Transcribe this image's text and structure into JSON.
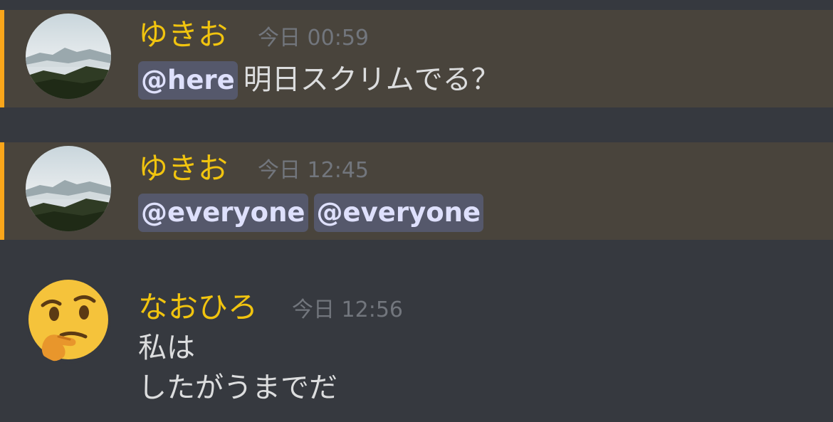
{
  "colors": {
    "background": "#36393f",
    "highlight_background": "#49443c",
    "highlight_border": "#faa61a",
    "username": "#f1c40f",
    "timestamp": "#72767d",
    "text": "#dcddde",
    "mention_text": "#dee0fc"
  },
  "messages": [
    {
      "author": "ゆきお",
      "timestamp": "今日 00:59",
      "avatar_icon": "mountain-landscape-avatar",
      "mentions": [
        "@here"
      ],
      "text": "明日スクリムでる？"
    },
    {
      "author": "ゆきお",
      "timestamp": "今日 12:45",
      "avatar_icon": "mountain-landscape-avatar",
      "mentions": [
        "@everyone",
        "@everyone"
      ]
    },
    {
      "author": "なおひろ",
      "timestamp": "今日 12:56",
      "avatar_icon": "thinking-face-emoji-avatar",
      "lines": [
        "私は",
        "したがうまでだ"
      ]
    }
  ]
}
